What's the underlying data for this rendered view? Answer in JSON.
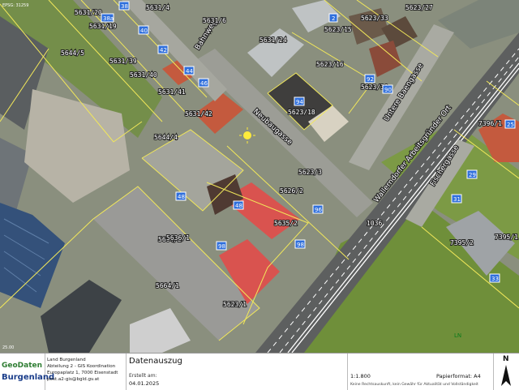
{
  "map": {
    "corner_note": "EPSG: 31259",
    "bottom_left_note": "25.00",
    "streets": [
      {
        "name": "Neubaugasse"
      },
      {
        "name": "Untere Baengasse"
      },
      {
        "name": "Wallerndorfer Arbeitsgründer Ort"
      },
      {
        "name": "Fischergasse"
      },
      {
        "name": "Bahnweg"
      }
    ],
    "parcels": [
      "5631/20",
      "5631/4",
      "5631/19",
      "5644/5",
      "5631/39",
      "5631/40",
      "5631/41",
      "5631/42",
      "5644/4",
      "5631/24",
      "5623/33",
      "5623/15",
      "5623/16",
      "5623/30",
      "5623/18",
      "5626/2",
      "5635/2",
      "5664/2",
      "5664/1",
      "5623/1",
      "1036",
      "5623/27",
      "7395/2",
      "7395/1",
      "7396/1",
      "5631/6",
      "5623/3",
      "5636/1"
    ],
    "house_numbers": [
      "38",
      "38a",
      "40",
      "42",
      "44",
      "46",
      "48",
      "48",
      "94",
      "2",
      "90",
      "92",
      "96",
      "98",
      "98",
      "29",
      "31",
      "33",
      "25"
    ],
    "field_label": "LN"
  },
  "footer": {
    "logo_geo": "GeoDaten",
    "logo_state": "Burgenland",
    "org_lines": [
      "Land Burgenland",
      "Abteilung 2 - GIS Koordination",
      "Europaplatz 1, 7000 Eisenstadt",
      "post.a2-gis@bgld.gv.at"
    ],
    "title": "Datenauszug",
    "created_label": "Erstellt am:",
    "created_date": "04.01.2025",
    "scale": "1:1.800",
    "paper_format": "Papierformat: A4",
    "disclaimer": "Keine Rechtsauskunft, kein Gewähr für Aktualität und Vollständigkeit",
    "north_label": "N"
  },
  "colors": {
    "parcel_line": "#f2e85a",
    "house_number_box": "#2f6fdc",
    "roof_red": "#d9534f",
    "field_green": "#6f8f3a"
  }
}
